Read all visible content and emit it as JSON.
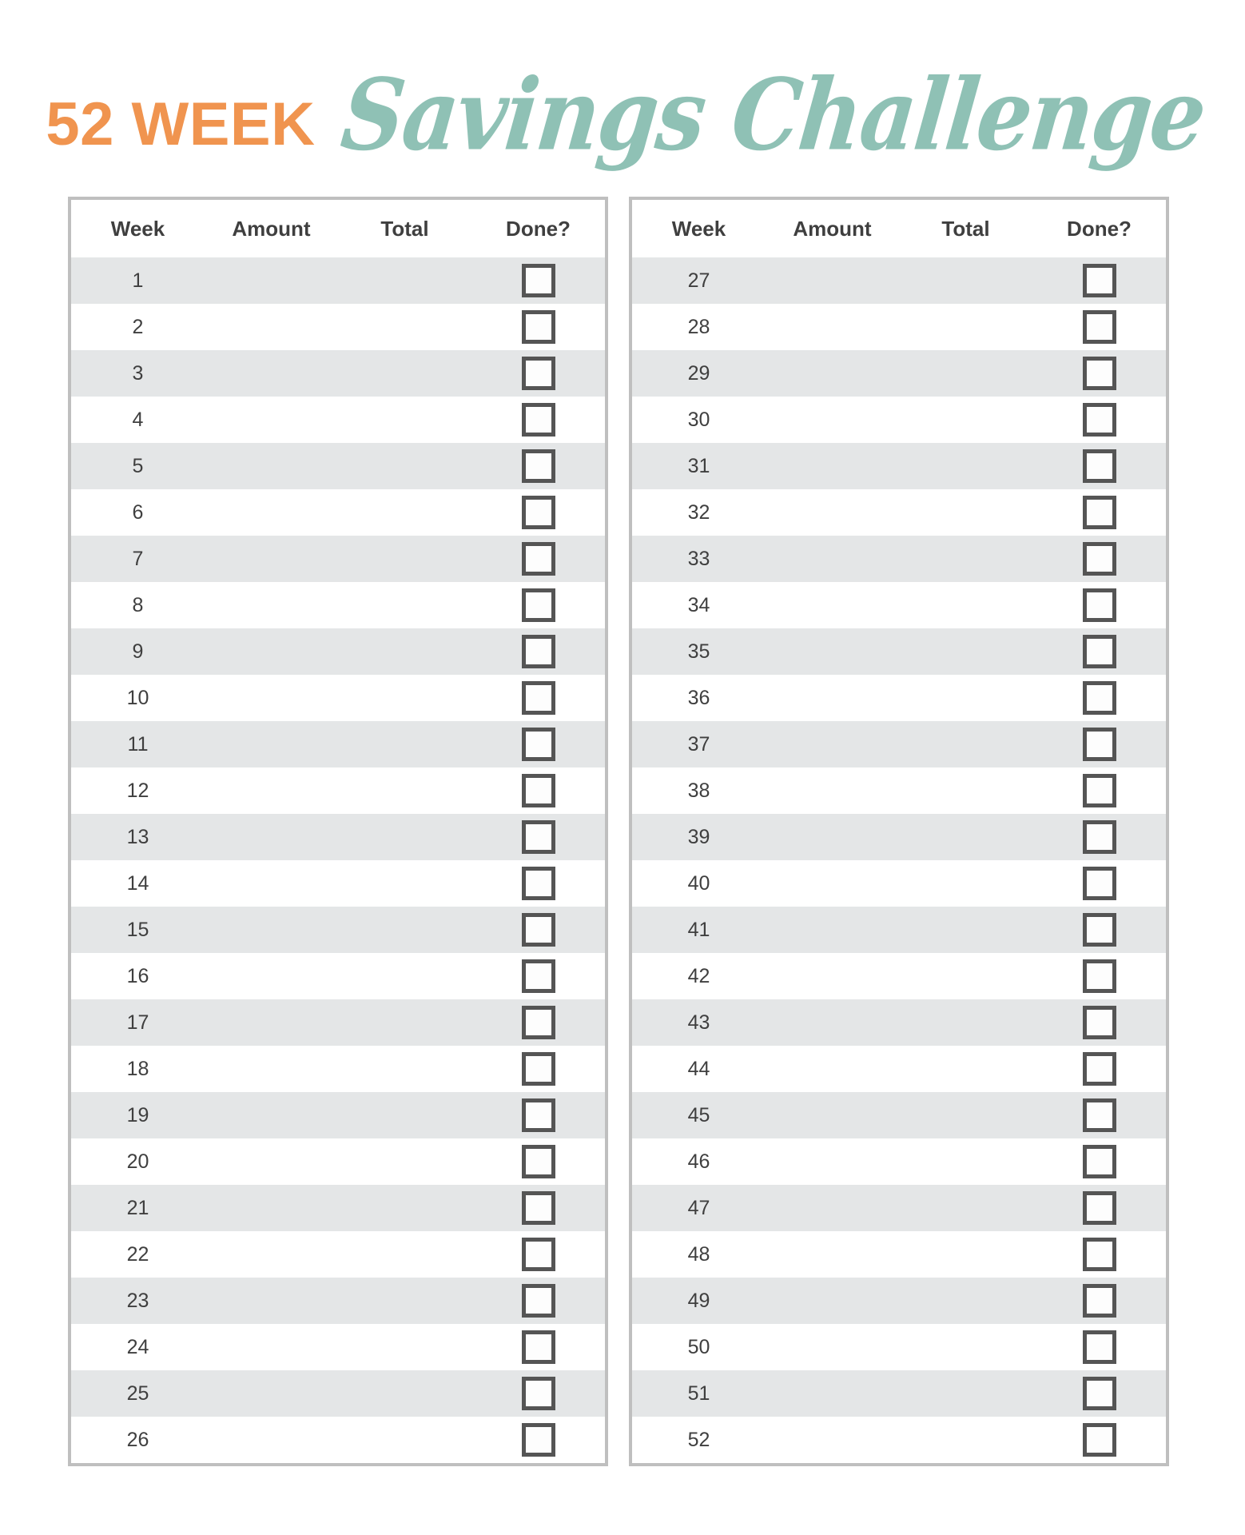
{
  "page": {
    "title_prefix": "52 WEEK",
    "title_script": "Savings Challenge",
    "accent_orange": "#F0944F",
    "accent_teal": "#8FC1B5",
    "stripe_color": "#E4E6E7",
    "border_color": "#BFBFBF",
    "text_color": "#3F3F3F",
    "checkbox_border_color": "#555555"
  },
  "columns": {
    "week": "Week",
    "amount": "Amount",
    "total": "Total",
    "done": "Done?"
  },
  "tables": [
    {
      "id": "weeks-1-26",
      "headers": [
        "Week",
        "Amount",
        "Total",
        "Done?"
      ],
      "rows": [
        {
          "week": "1",
          "amount": "",
          "total": "",
          "done": false
        },
        {
          "week": "2",
          "amount": "",
          "total": "",
          "done": false
        },
        {
          "week": "3",
          "amount": "",
          "total": "",
          "done": false
        },
        {
          "week": "4",
          "amount": "",
          "total": "",
          "done": false
        },
        {
          "week": "5",
          "amount": "",
          "total": "",
          "done": false
        },
        {
          "week": "6",
          "amount": "",
          "total": "",
          "done": false
        },
        {
          "week": "7",
          "amount": "",
          "total": "",
          "done": false
        },
        {
          "week": "8",
          "amount": "",
          "total": "",
          "done": false
        },
        {
          "week": "9",
          "amount": "",
          "total": "",
          "done": false
        },
        {
          "week": "10",
          "amount": "",
          "total": "",
          "done": false
        },
        {
          "week": "11",
          "amount": "",
          "total": "",
          "done": false
        },
        {
          "week": "12",
          "amount": "",
          "total": "",
          "done": false
        },
        {
          "week": "13",
          "amount": "",
          "total": "",
          "done": false
        },
        {
          "week": "14",
          "amount": "",
          "total": "",
          "done": false
        },
        {
          "week": "15",
          "amount": "",
          "total": "",
          "done": false
        },
        {
          "week": "16",
          "amount": "",
          "total": "",
          "done": false
        },
        {
          "week": "17",
          "amount": "",
          "total": "",
          "done": false
        },
        {
          "week": "18",
          "amount": "",
          "total": "",
          "done": false
        },
        {
          "week": "19",
          "amount": "",
          "total": "",
          "done": false
        },
        {
          "week": "20",
          "amount": "",
          "total": "",
          "done": false
        },
        {
          "week": "21",
          "amount": "",
          "total": "",
          "done": false
        },
        {
          "week": "22",
          "amount": "",
          "total": "",
          "done": false
        },
        {
          "week": "23",
          "amount": "",
          "total": "",
          "done": false
        },
        {
          "week": "24",
          "amount": "",
          "total": "",
          "done": false
        },
        {
          "week": "25",
          "amount": "",
          "total": "",
          "done": false
        },
        {
          "week": "26",
          "amount": "",
          "total": "",
          "done": false
        }
      ]
    },
    {
      "id": "weeks-27-52",
      "headers": [
        "Week",
        "Amount",
        "Total",
        "Done?"
      ],
      "rows": [
        {
          "week": "27",
          "amount": "",
          "total": "",
          "done": false
        },
        {
          "week": "28",
          "amount": "",
          "total": "",
          "done": false
        },
        {
          "week": "29",
          "amount": "",
          "total": "",
          "done": false
        },
        {
          "week": "30",
          "amount": "",
          "total": "",
          "done": false
        },
        {
          "week": "31",
          "amount": "",
          "total": "",
          "done": false
        },
        {
          "week": "32",
          "amount": "",
          "total": "",
          "done": false
        },
        {
          "week": "33",
          "amount": "",
          "total": "",
          "done": false
        },
        {
          "week": "34",
          "amount": "",
          "total": "",
          "done": false
        },
        {
          "week": "35",
          "amount": "",
          "total": "",
          "done": false
        },
        {
          "week": "36",
          "amount": "",
          "total": "",
          "done": false
        },
        {
          "week": "37",
          "amount": "",
          "total": "",
          "done": false
        },
        {
          "week": "38",
          "amount": "",
          "total": "",
          "done": false
        },
        {
          "week": "39",
          "amount": "",
          "total": "",
          "done": false
        },
        {
          "week": "40",
          "amount": "",
          "total": "",
          "done": false
        },
        {
          "week": "41",
          "amount": "",
          "total": "",
          "done": false
        },
        {
          "week": "42",
          "amount": "",
          "total": "",
          "done": false
        },
        {
          "week": "43",
          "amount": "",
          "total": "",
          "done": false
        },
        {
          "week": "44",
          "amount": "",
          "total": "",
          "done": false
        },
        {
          "week": "45",
          "amount": "",
          "total": "",
          "done": false
        },
        {
          "week": "46",
          "amount": "",
          "total": "",
          "done": false
        },
        {
          "week": "47",
          "amount": "",
          "total": "",
          "done": false
        },
        {
          "week": "48",
          "amount": "",
          "total": "",
          "done": false
        },
        {
          "week": "49",
          "amount": "",
          "total": "",
          "done": false
        },
        {
          "week": "50",
          "amount": "",
          "total": "",
          "done": false
        },
        {
          "week": "51",
          "amount": "",
          "total": "",
          "done": false
        },
        {
          "week": "52",
          "amount": "",
          "total": "",
          "done": false
        }
      ]
    }
  ]
}
